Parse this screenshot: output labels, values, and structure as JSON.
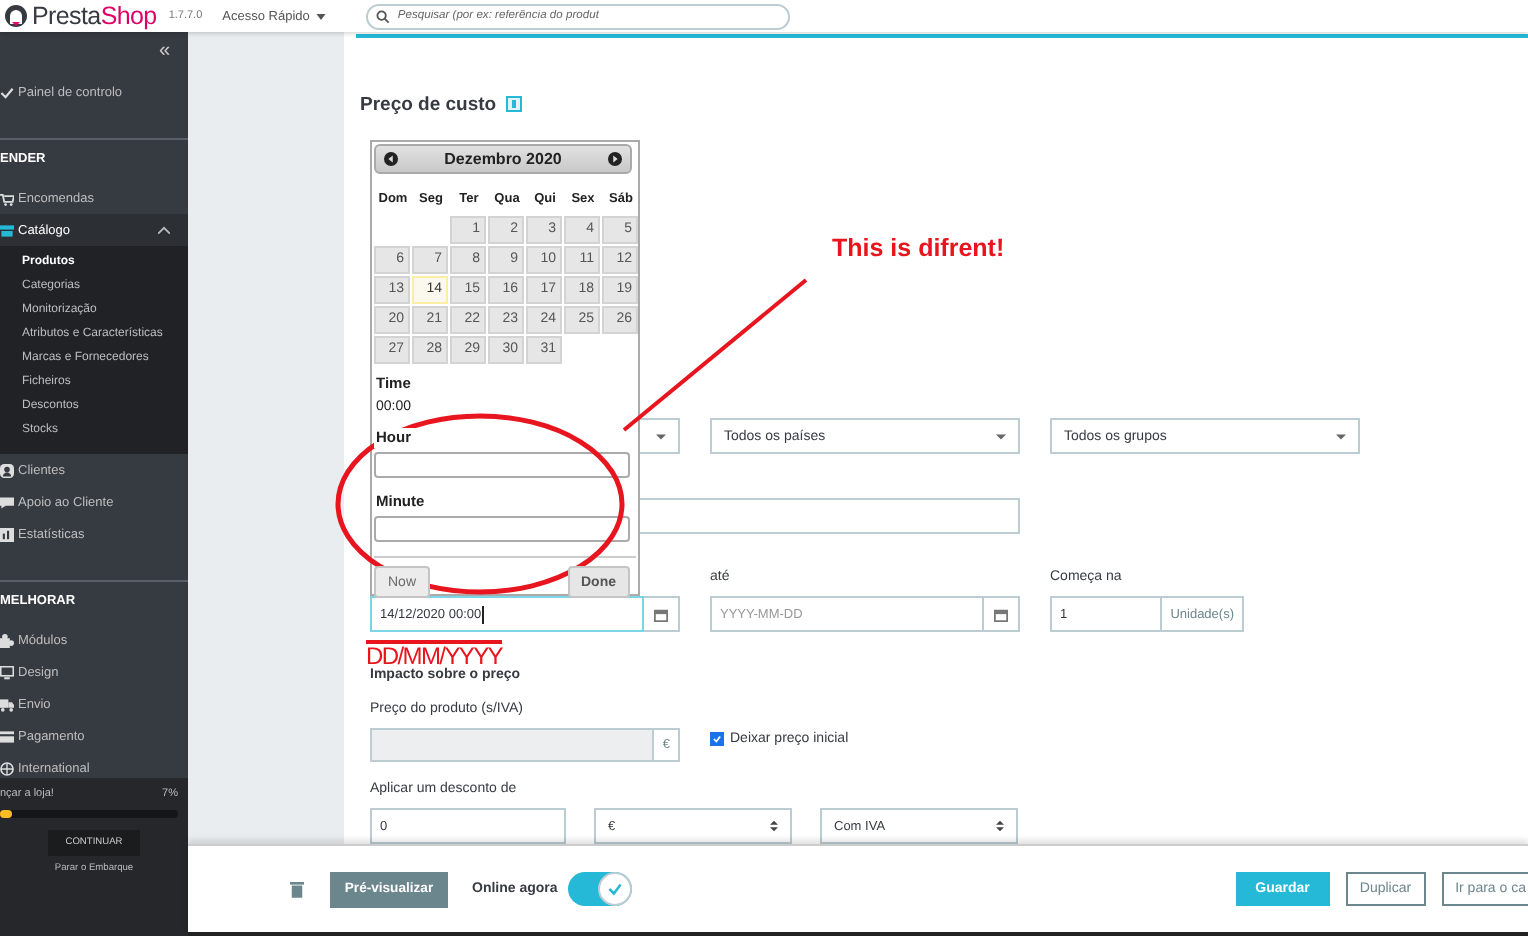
{
  "header": {
    "brand_dark": "Presta",
    "brand_accent": "Shop",
    "version": "1.7.7.0",
    "quick_access": "Acesso Rápido",
    "search": {
      "placeholder": "Pesquisar (por ex: referência do produt"
    }
  },
  "sidebar": {
    "collapse": "«",
    "sections": [
      {
        "items": [
          {
            "label": "Painel de controlo",
            "selected": false
          }
        ]
      },
      {
        "title": "ENDER",
        "items": [
          {
            "label": "Encomendas",
            "selected": false
          },
          {
            "label": "Catálogo",
            "selected": true,
            "expanded": true,
            "children": [
              {
                "label": "Produtos",
                "selected": true
              },
              {
                "label": "Categorias",
                "selected": false
              },
              {
                "label": "Monitorização",
                "selected": false
              },
              {
                "label": "Atributos e Características",
                "selected": false
              },
              {
                "label": "Marcas e Fornecedores",
                "selected": false
              },
              {
                "label": "Ficheiros",
                "selected": false
              },
              {
                "label": "Descontos",
                "selected": false
              },
              {
                "label": "Stocks",
                "selected": false
              }
            ]
          },
          {
            "label": "Clientes",
            "selected": false
          },
          {
            "label": "Apoio ao Cliente",
            "selected": false
          },
          {
            "label": "Estatísticas",
            "selected": false
          }
        ]
      },
      {
        "title": "MELHORAR",
        "items": [
          {
            "label": "Módulos",
            "selected": false
          },
          {
            "label": "Design",
            "selected": false
          },
          {
            "label": "Envio",
            "selected": false
          },
          {
            "label": "Pagamento",
            "selected": false
          },
          {
            "label": "International",
            "selected": false
          }
        ]
      }
    ],
    "onboarding": {
      "label": "nçar a loja!",
      "percent": "7%",
      "level": 0.07,
      "button": "CONTINUAR",
      "link": "Parar o Embarque"
    }
  },
  "content": {
    "section_title": "Preço de custo",
    "selects": [
      {
        "value": "Todos os países"
      },
      {
        "value": "Todos os grupos"
      }
    ],
    "date_from": {
      "value": "14/12/2020 00:00",
      "focused": true
    },
    "date_to": {
      "label": "até",
      "placeholder": "YYYY-MM-DD"
    },
    "starts_at": {
      "label": "Começa na",
      "value": "1",
      "unit": "Unidade(s)"
    },
    "impact_title": "Impacto sobre o preço",
    "product_price": {
      "label": "Preço do produto (s/IVA)",
      "currency": "€",
      "disabled": true
    },
    "keep_price": {
      "label": "Deixar preço inicial",
      "checked": true
    },
    "discount": {
      "label": "Aplicar um desconto de",
      "value": "0",
      "type": "€",
      "tax": "Com IVA"
    }
  },
  "datepicker": {
    "month": "Dezembro 2020",
    "weekdays": [
      "Dom",
      "Seg",
      "Ter",
      "Qua",
      "Qui",
      "Sex",
      "Sáb"
    ],
    "weeks": [
      {
        "days": [
          {
            "kind": "blank"
          },
          {
            "kind": "blank"
          },
          {
            "day": "1",
            "selected": false
          },
          {
            "day": "2",
            "selected": false
          },
          {
            "day": "3",
            "selected": false
          },
          {
            "day": "4",
            "selected": false
          },
          {
            "day": "5",
            "selected": false
          }
        ]
      },
      {
        "days": [
          {
            "day": "6",
            "selected": false
          },
          {
            "day": "7",
            "selected": false
          },
          {
            "day": "8",
            "selected": false
          },
          {
            "day": "9",
            "selected": false
          },
          {
            "day": "10",
            "selected": false
          },
          {
            "day": "11",
            "selected": false
          },
          {
            "day": "12",
            "selected": false
          }
        ]
      },
      {
        "days": [
          {
            "day": "13",
            "selected": false
          },
          {
            "day": "14",
            "selected": true
          },
          {
            "day": "15",
            "selected": false
          },
          {
            "day": "16",
            "selected": false
          },
          {
            "day": "17",
            "selected": false
          },
          {
            "day": "18",
            "selected": false
          },
          {
            "day": "19",
            "selected": false
          }
        ]
      },
      {
        "days": [
          {
            "day": "20",
            "selected": false
          },
          {
            "day": "21",
            "selected": false
          },
          {
            "day": "22",
            "selected": false
          },
          {
            "day": "23",
            "selected": false
          },
          {
            "day": "24",
            "selected": false
          },
          {
            "day": "25",
            "selected": false
          },
          {
            "day": "26",
            "selected": false
          }
        ]
      },
      {
        "days": [
          {
            "day": "27",
            "selected": false
          },
          {
            "day": "28",
            "selected": false
          },
          {
            "day": "29",
            "selected": false
          },
          {
            "day": "30",
            "selected": false
          },
          {
            "day": "31",
            "selected": false
          }
        ]
      }
    ],
    "time_label": "Time",
    "time_value": "00:00",
    "hour_label": "Hour",
    "minute_label": "Minute",
    "now_button": {
      "label": "Now",
      "disabled": true
    },
    "done_button": {
      "label": "Done",
      "disabled": false
    }
  },
  "annotations": {
    "callout": "This is difrent!",
    "format_note": "DD/MM/YYYY"
  },
  "footer": {
    "preview": "Pré-visualizar",
    "online_label": "Online agora",
    "online": true,
    "buttons": [
      {
        "label": "Guardar",
        "kind": "primary"
      },
      {
        "label": "Duplicar",
        "kind": "outline"
      },
      {
        "label": "Ir para o ca",
        "kind": "outline"
      }
    ]
  }
}
